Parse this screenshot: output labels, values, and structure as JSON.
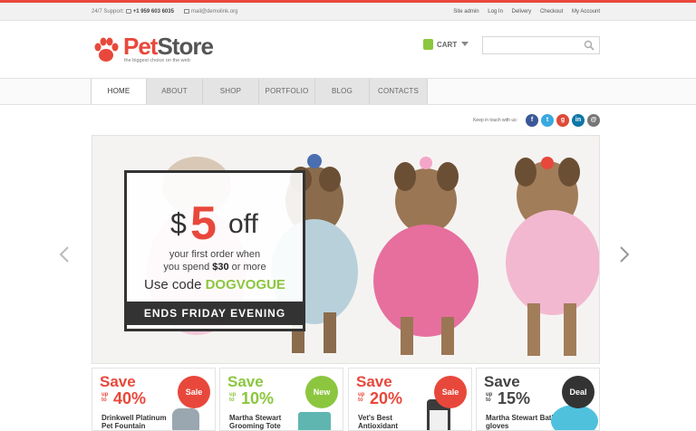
{
  "topbar": {
    "support_label": "24/7 Support:",
    "phone": "+1 959 603 6035",
    "email": "mail@demolink.org",
    "links": [
      "Site admin",
      "Log In",
      "Delivery",
      "Checkout",
      "My Account"
    ]
  },
  "logo": {
    "name_part1": "Pet",
    "name_part2": "Store",
    "tagline": "the biggest choice on the web"
  },
  "cart": {
    "label": "CART"
  },
  "search": {
    "placeholder": ""
  },
  "nav": {
    "tabs": [
      "HOME",
      "ABOUT",
      "SHOP",
      "PORTFOLIO",
      "BLOG",
      "CONTACTS"
    ],
    "active": "HOME"
  },
  "social": {
    "label": "Keep in touch with us:",
    "icons": [
      "facebook-icon",
      "twitter-icon",
      "google-plus-icon",
      "linkedin-icon",
      "email-icon"
    ]
  },
  "slider": {
    "promo_currency": "$",
    "promo_amount": "5",
    "promo_off": "off",
    "promo_line1": "your first order when",
    "promo_line2_prefix": "you spend ",
    "promo_line2_amount": "$30",
    "promo_line2_suffix": " or more",
    "promo_code_label": "Use code ",
    "promo_code": "DOGVOGUE",
    "promo_banner": "ENDS FRIDAY EVENING"
  },
  "cards": [
    {
      "save": "Save",
      "upto": "up to",
      "percent": "40%",
      "name": "Drinkwell Platinum Pet Fountain",
      "badge": "Sale"
    },
    {
      "save": "Save",
      "upto": "up to",
      "percent": "10%",
      "name": "Martha Stewart Grooming Tote",
      "badge": "New"
    },
    {
      "save": "Save",
      "upto": "up to",
      "percent": "20%",
      "name": "Vet's Best Antioxidant",
      "badge": "Sale"
    },
    {
      "save": "Save",
      "upto": "up to",
      "percent": "15%",
      "name": "Martha Stewart Bath gloves",
      "badge": "Deal"
    }
  ],
  "colors": {
    "accent_red": "#e8483b",
    "accent_green": "#8cc63f",
    "dark": "#333333"
  }
}
